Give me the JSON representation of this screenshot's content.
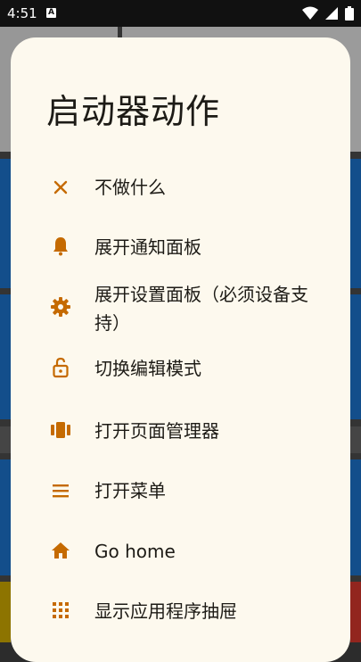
{
  "status_bar": {
    "time": "4:51",
    "notification_glyph": "A",
    "icons": [
      "wifi-icon",
      "signal-icon",
      "battery-icon"
    ]
  },
  "dialog": {
    "title": "启动器动作",
    "accent_color": "#c56a00",
    "items": [
      {
        "icon": "close-icon",
        "label": "不做什么"
      },
      {
        "icon": "bell-icon",
        "label": "展开通知面板"
      },
      {
        "icon": "gear-icon",
        "label": "展开设置面板（必须设备支持）"
      },
      {
        "icon": "lock-open-icon",
        "label": "切换编辑模式"
      },
      {
        "icon": "pages-icon",
        "label": "打开页面管理器"
      },
      {
        "icon": "menu-icon",
        "label": "打开菜单"
      },
      {
        "icon": "home-icon",
        "label": "Go home"
      },
      {
        "icon": "apps-grid-icon",
        "label": "显示应用程序抽屉"
      }
    ]
  }
}
